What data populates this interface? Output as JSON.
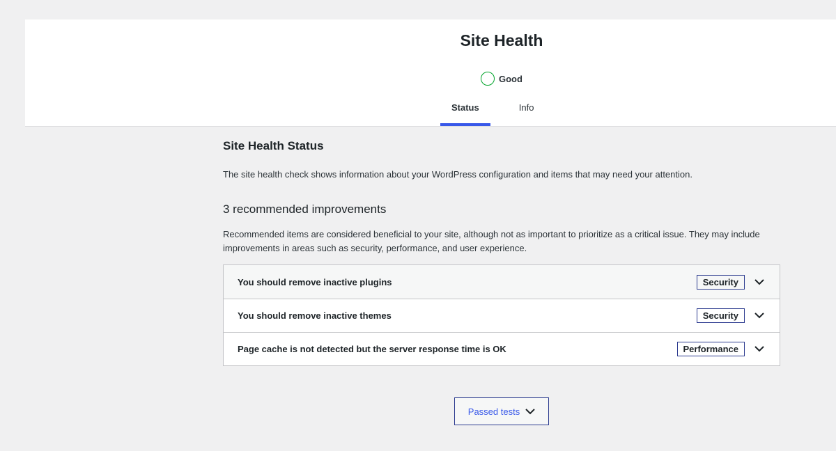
{
  "header": {
    "title": "Site Health",
    "status_label": "Good",
    "tabs": [
      {
        "label": "Status",
        "active": true
      },
      {
        "label": "Info",
        "active": false
      }
    ]
  },
  "main": {
    "section_title": "Site Health Status",
    "description": "The site health check shows information about your WordPress configuration and items that may need your attention.",
    "recommended_title": "3 recommended improvements",
    "recommended_description": "Recommended items are considered beneficial to your site, although not as important to prioritize as a critical issue. They may include improvements in areas such as security, performance, and user experience.",
    "issues": [
      {
        "title": "You should remove inactive plugins",
        "badge": "Security",
        "icon": "chevron-down-icon"
      },
      {
        "title": "You should remove inactive themes",
        "badge": "Security",
        "icon": "chevron-down-icon"
      },
      {
        "title": "Page cache is not detected but the server response time is OK",
        "badge": "Performance",
        "icon": "chevron-down-icon"
      }
    ],
    "passed_tests_label": "Passed tests"
  },
  "colors": {
    "accent": "#3858e9",
    "good": "#00a32a",
    "badge_border": "#2c3b8f"
  }
}
